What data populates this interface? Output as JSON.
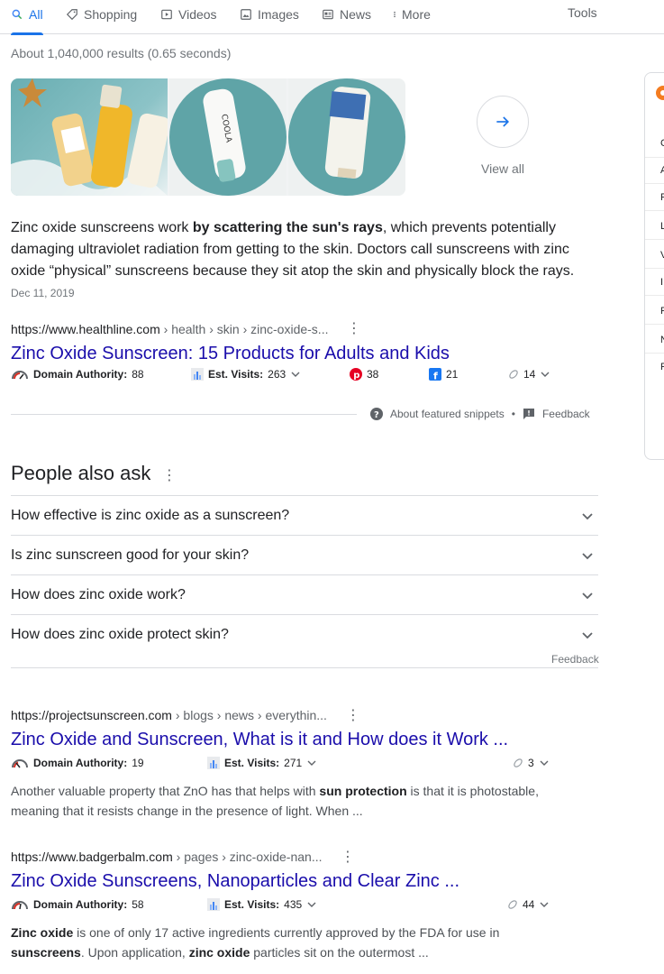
{
  "nav": {
    "tabs": [
      {
        "label": "All",
        "icon": "search-icon",
        "active": true
      },
      {
        "label": "Shopping",
        "icon": "tag-icon"
      },
      {
        "label": "Videos",
        "icon": "video-icon"
      },
      {
        "label": "Images",
        "icon": "image-icon"
      },
      {
        "label": "News",
        "icon": "news-icon"
      },
      {
        "label": "More",
        "icon": "more-icon"
      }
    ],
    "tools_label": "Tools"
  },
  "stats": "About 1,040,000 results (0.65 seconds)",
  "images_strip": {
    "view_all_label": "View all"
  },
  "featured": {
    "text_before": "Zinc oxide sunscreens work ",
    "text_bold": "by scattering the sun's rays",
    "text_after": ", which prevents potentially damaging ultraviolet radiation from getting to the skin. Doctors call sunscreens with zinc oxide “physical” sunscreens because they sit atop the skin and physically block the rays.",
    "date": "Dec 11, 2019",
    "url_host": "https://www.healthline.com",
    "url_path": " › health › skin › zinc-oxide-s...",
    "title": "Zinc Oxide Sunscreen: 15 Products for Adults and Kids",
    "metrics": {
      "da_label": "Domain Authority:",
      "da_value": "88",
      "visits_label": "Est. Visits:",
      "visits_value": "263",
      "pinterest": "38",
      "facebook": "21",
      "links": "14"
    },
    "about_label": "About featured snippets",
    "dot": "•",
    "feedback_label": "Feedback"
  },
  "paa": {
    "title": "People also ask",
    "questions": [
      "How effective is zinc oxide as a sunscreen?",
      "Is zinc sunscreen good for your skin?",
      "How does zinc oxide work?",
      "How does zinc oxide protect skin?"
    ],
    "feedback_label": "Feedback"
  },
  "results": [
    {
      "url_host": "https://projectsunscreen.com",
      "url_path": " › blogs › news › everythin...",
      "title": "Zinc Oxide and Sunscreen, What is it and How does it Work ...",
      "da_label": "Domain Authority:",
      "da_value": "19",
      "visits_label": "Est. Visits:",
      "visits_value": "271",
      "links": "3",
      "desc_1": "Another valuable property that ZnO has that helps with ",
      "desc_b1": "sun protection",
      "desc_2": " is that it is photostable, meaning that it resists change in the presence of light. When ..."
    },
    {
      "url_host": "https://www.badgerbalm.com",
      "url_path": " › pages › zinc-oxide-nan...",
      "title": "Zinc Oxide Sunscreens, Nanoparticles and Clear Zinc ...",
      "da_label": "Domain Authority:",
      "da_value": "58",
      "visits_label": "Est. Visits:",
      "visits_value": "435",
      "links": "44",
      "desc_b1": "Zinc oxide",
      "desc_1": " is one of only 17 active ingredients currently approved by the FDA for use in ",
      "desc_b2": "sunscreens",
      "desc_2": ". Upon application, ",
      "desc_b3": "zinc oxide",
      "desc_3": " particles sit on the outermost ..."
    }
  ],
  "right_panel": {
    "letters": [
      "C",
      "A",
      "F",
      "L",
      "V",
      "I",
      "F",
      "N",
      "F"
    ]
  },
  "colors": {
    "link": "#1a0dab",
    "accent": "#1a73e8",
    "pinterest": "#e60023",
    "facebook": "#1877f2",
    "gauge": "#d93025"
  }
}
